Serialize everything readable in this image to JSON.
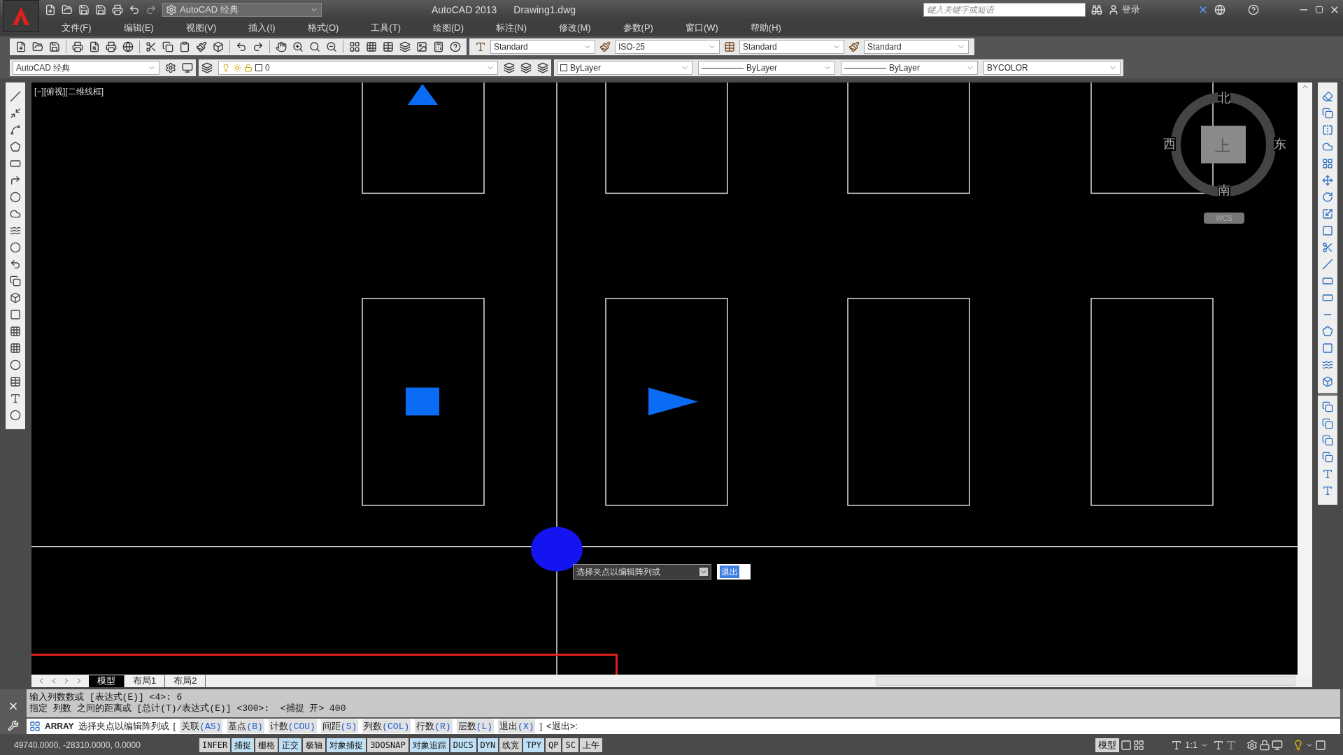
{
  "quick_access": {
    "workspace": "AutoCAD 经典"
  },
  "title": {
    "app_name": "AutoCAD 2013",
    "file_name": "Drawing1.dwg"
  },
  "search": {
    "placeholder": "键入关键字或短语"
  },
  "sign_in": "登录",
  "menu": [
    "文件(F)",
    "编辑(E)",
    "视图(V)",
    "插入(I)",
    "格式(O)",
    "工具(T)",
    "绘图(D)",
    "标注(N)",
    "修改(M)",
    "参数(P)",
    "窗口(W)",
    "帮助(H)"
  ],
  "styles_toolbar": [
    {
      "kind": "text",
      "value": "Standard"
    },
    {
      "kind": "dimension",
      "value": "ISO-25"
    },
    {
      "kind": "table",
      "value": "Standard"
    },
    {
      "kind": "multileader",
      "value": "Standard"
    }
  ],
  "workspace_toolbar": {
    "value": "AutoCAD 经典"
  },
  "layer": {
    "value": "0"
  },
  "properties": [
    {
      "kind": "color",
      "value": "ByLayer"
    },
    {
      "kind": "linetype",
      "value": "ByLayer"
    },
    {
      "kind": "lineweight",
      "value": "ByLayer"
    },
    {
      "kind": "plotstyle",
      "value": "BYCOLOR"
    }
  ],
  "viewport_label": "[−][俯视][二维线框]",
  "viewcube": {
    "north": "北",
    "south": "南",
    "west": "西",
    "east": "东",
    "face": "上",
    "ucs": "WCS"
  },
  "grip_menu": {
    "prompt": "选择夹点以编辑阵列或",
    "button": "退出"
  },
  "layout_tabs": [
    {
      "label": "模型",
      "selected": true
    },
    {
      "label": "布局1",
      "selected": false
    },
    {
      "label": "布局2",
      "selected": false
    }
  ],
  "command_history": [
    "输入列数数或 [表达式(E)] <4>: 6",
    "指定 列数 之间的距离或 [总计(T)/表达式(E)] <300>:  <捕捉 开> 400"
  ],
  "command_line": {
    "command": "ARRAY",
    "prompt": "选择夹点以编辑阵列或",
    "open_bracket": "[",
    "close_bracket": "]",
    "default": "<退出>:",
    "options": [
      {
        "label": "关联",
        "key": "(AS)"
      },
      {
        "label": "基点",
        "key": "(B)"
      },
      {
        "label": "计数",
        "key": "(COU)"
      },
      {
        "label": "间距",
        "key": "(S)"
      },
      {
        "label": "列数",
        "key": "(COL)"
      },
      {
        "label": "行数",
        "key": "(R)"
      },
      {
        "label": "层数",
        "key": "(L)"
      },
      {
        "label": "退出",
        "key": "(X)"
      }
    ]
  },
  "coordinates": "49740.0000, -28310.0000, 0.0000",
  "status_toggles": [
    {
      "label": "INFER",
      "on": false
    },
    {
      "label": "捕捉",
      "on": true
    },
    {
      "label": "栅格",
      "on": false
    },
    {
      "label": "正交",
      "on": true
    },
    {
      "label": "极轴",
      "on": false
    },
    {
      "label": "对象捕捉",
      "on": true
    },
    {
      "label": "3DOSNAP",
      "on": false
    },
    {
      "label": "对象追踪",
      "on": true
    },
    {
      "label": "DUCS",
      "on": true
    },
    {
      "label": "DYN",
      "on": true
    },
    {
      "label": "线宽",
      "on": false
    },
    {
      "label": "TPY",
      "on": true
    },
    {
      "label": "QP",
      "on": false
    },
    {
      "label": "SC",
      "on": false
    },
    {
      "label": "上午",
      "on": false
    }
  ],
  "status_right": {
    "model": "模型",
    "scale": "1:1"
  }
}
